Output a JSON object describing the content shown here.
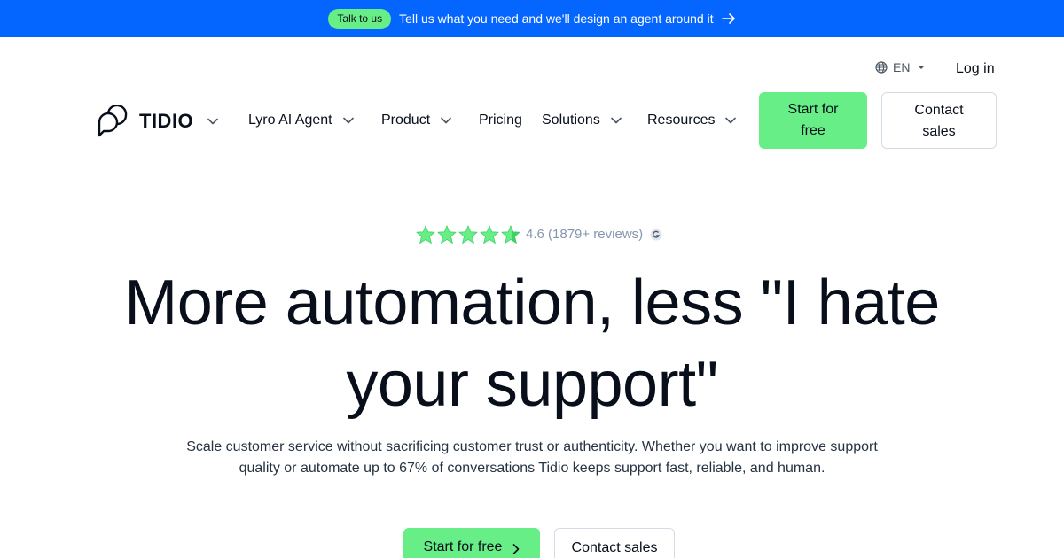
{
  "banner": {
    "pill_label": "Talk to us",
    "text": "Tell us what you need and we'll design an agent around it",
    "background": "#0566ff"
  },
  "utility": {
    "language": "EN",
    "login_label": "Log in"
  },
  "nav": {
    "logo_text": "TIDIO",
    "items": [
      {
        "label": "Lyro AI Agent"
      },
      {
        "label": "Product"
      },
      {
        "label": "Pricing"
      },
      {
        "label": "Solutions"
      },
      {
        "label": "Resources"
      }
    ],
    "start_line1": "Start for",
    "start_line2": "free",
    "contact_line1": "Contact",
    "contact_line2": "sales"
  },
  "rating": {
    "stars": 5,
    "text": "4.6 (1879+ reviews)",
    "star_color": "#67ee86"
  },
  "hero": {
    "headline_line1": "More automation, less \"I hate",
    "headline_line2": "your support\"",
    "sub_line1": "Scale customer service without sacrificing customer trust or authenticity. Whether you want to improve support",
    "sub_line2": "quality or automate up to 67% of conversations Tidio keeps support fast, reliable, and human.",
    "cta_primary": "Start for free",
    "cta_secondary": "Contact sales"
  },
  "colors": {
    "accent_green": "#67ee86",
    "text": "#080f1a",
    "brand_blue": "#0566ff"
  }
}
